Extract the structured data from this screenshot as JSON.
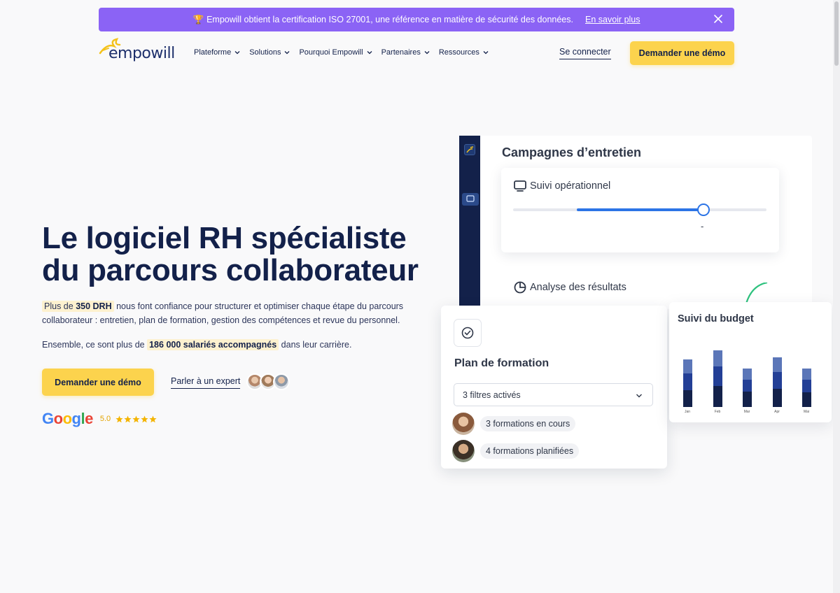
{
  "announcement": {
    "trophy": "🏆",
    "text": "Empowill obtient la certification ISO 27001, une référence en matière de sécurité des données.",
    "link": "En savoir plus"
  },
  "logo": {
    "text": "empowill"
  },
  "nav": {
    "items": [
      {
        "label": "Plateforme"
      },
      {
        "label": "Solutions"
      },
      {
        "label": "Pourquoi Empowill"
      },
      {
        "label": "Partenaires"
      },
      {
        "label": "Ressources"
      }
    ],
    "login": "Se connecter",
    "demo": "Demander une démo"
  },
  "hero": {
    "title": "Le logiciel RH spécialiste du parcours collaborateur",
    "p1_prefix": "Plus de",
    "p1_bold": "350 DRH",
    "p1_rest": "nous font confiance pour structurer et optimiser chaque étape du parcours collaborateur : entretien, plan de formation, gestion des compétences et revue du personnel.",
    "p2_prefix": "Ensemble, ce sont plus de",
    "p2_bold": "186 000 salariés accompagnés",
    "p2_suffix": "dans leur carrière.",
    "cta": "Demander une démo",
    "expert": "Parler à un expert"
  },
  "rating": {
    "brand": "Google",
    "score": "5.0",
    "stars": 5
  },
  "mock": {
    "campaigns_title": "Campagnes d’entretien",
    "suivi_label": "Suivi opérationnel",
    "slider": {
      "start": 0.25,
      "end": 0.75
    },
    "slider_value": "-",
    "analyse_label": "Analyse des résultats",
    "formation_title": "Plan de formation",
    "filter_value": "3 filtres activés",
    "rows": [
      {
        "label": "3 formations en cours"
      },
      {
        "label": "4 formations planifiées"
      }
    ],
    "budget_title": "Suivi du budget",
    "budget_months": [
      "Jan",
      "Feb",
      "Mar",
      "Apr",
      "Mai"
    ]
  },
  "colors": {
    "announce_bg": "#8b63f5",
    "accent_yellow": "#fcd34d",
    "navy": "#13214a",
    "slider_blue": "#2c74e6"
  }
}
